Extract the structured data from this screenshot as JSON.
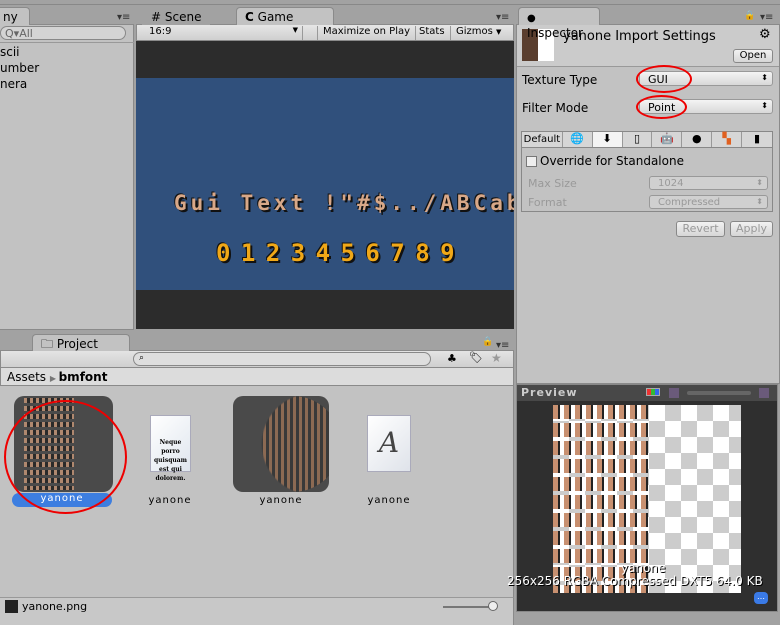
{
  "hierarchy": {
    "tab_label": "ny",
    "search_placeholder": "All",
    "items": [
      "scii",
      "umber",
      "nera"
    ]
  },
  "game_view": {
    "tabs": [
      {
        "label": "Scene",
        "icon": "grid-icon"
      },
      {
        "label": "Game",
        "icon": "pacman-icon"
      }
    ],
    "aspect": "16:9",
    "maximize_on_play": "Maximize on Play",
    "stats": "Stats",
    "gizmos": "Gizmos",
    "text_line": "Gui Text !\"#$../ABCabcg",
    "number_line": "0 1 2 3 4 5 6 7 8 9",
    "colors": {
      "background": "#30507c",
      "letterbox": "#2c2c2c",
      "text": "#d8a888",
      "numbers": "#f0a818"
    }
  },
  "project": {
    "tab_label": "Project",
    "breadcrumb": [
      "Assets",
      "bmfont"
    ],
    "assets": [
      {
        "label": "yanone",
        "type": "texture",
        "selected": true
      },
      {
        "label": "yanone",
        "type": "document",
        "doc_text": "Neque porro quisquam est qui dolorem."
      },
      {
        "label": "yanone",
        "type": "material"
      },
      {
        "label": "yanone",
        "type": "font",
        "glyph": "A"
      }
    ],
    "status_file": "yanone.png"
  },
  "inspector": {
    "tab_label": "Inspector",
    "title": "yanone Import Settings",
    "open_button": "Open",
    "texture_type_label": "Texture Type",
    "texture_type_value": "GUI",
    "filter_mode_label": "Filter Mode",
    "filter_mode_value": "Point",
    "platform_tabs": [
      "Default",
      "web",
      "standalone",
      "iphone",
      "android",
      "blackberry",
      "windows",
      "flash"
    ],
    "override_label": "Override for Standalone",
    "override_checked": false,
    "max_size_label": "Max Size",
    "max_size_value": "1024",
    "format_label": "Format",
    "format_value": "Compressed",
    "revert": "Revert",
    "apply": "Apply"
  },
  "preview": {
    "title": "Preview",
    "asset_name": "yanone",
    "info": "256x256  RGBA Compressed DXT5   64.0 KB"
  },
  "annotation_color": "#e00000"
}
